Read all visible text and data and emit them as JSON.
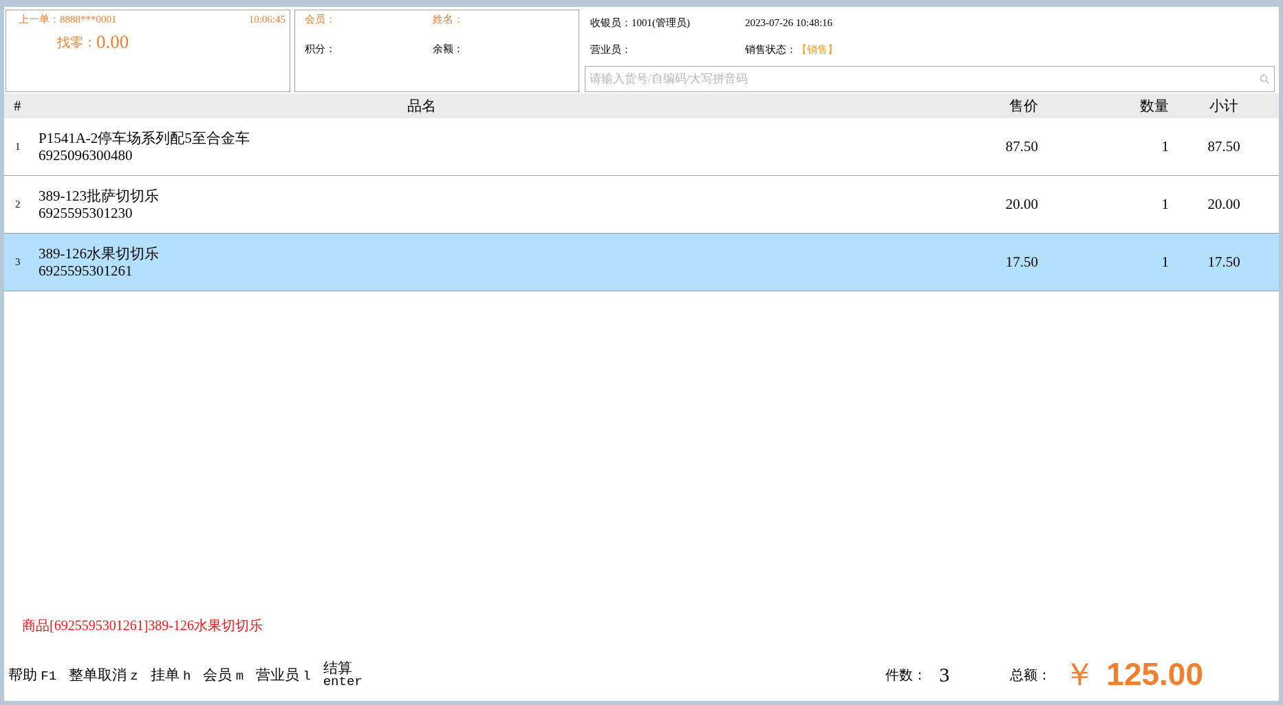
{
  "last_order": {
    "label": "上一单：8888***0001",
    "time": "10:06:45",
    "change_label": "找零：",
    "change_value": "0.00"
  },
  "member": {
    "member_label": "会员：",
    "name_label": "姓名：",
    "points_label": "积分：",
    "balance_label": "余额："
  },
  "info": {
    "cashier": "收银员：1001(管理员)",
    "datetime": "2023-07-26 10:48:16",
    "salesperson": "营业员：",
    "status_label": "销售状态：",
    "status_value": "【销售】"
  },
  "search": {
    "placeholder": "请输入货号/自编码/大写拼音码"
  },
  "table": {
    "columns": [
      "#",
      "品名",
      "售价",
      "数量",
      "小计"
    ],
    "rows": [
      {
        "index": "1",
        "name": "P1541A-2停车场系列配5至合金车",
        "code": "6925096300480",
        "price": "87.50",
        "qty": "1",
        "subtotal": "87.50",
        "selected": false
      },
      {
        "index": "2",
        "name": "389-123批萨切切乐",
        "code": "6925595301230",
        "price": "20.00",
        "qty": "1",
        "subtotal": "20.00",
        "selected": false
      },
      {
        "index": "3",
        "name": "389-126水果切切乐",
        "code": "6925595301261",
        "price": "17.50",
        "qty": "1",
        "subtotal": "17.50",
        "selected": true
      }
    ]
  },
  "message": "商品[6925595301261]389-126水果切切乐",
  "shortcuts": [
    {
      "kind": "inline",
      "label": "帮助",
      "key": "F1"
    },
    {
      "kind": "inline",
      "label": "整单取消",
      "key": "z"
    },
    {
      "kind": "inline",
      "label": "挂单",
      "key": "h"
    },
    {
      "kind": "inline",
      "label": "会员",
      "key": "m"
    },
    {
      "kind": "inline",
      "label": "营业员",
      "key": "l"
    },
    {
      "kind": "stacked",
      "label": "结算",
      "key": "enter"
    }
  ],
  "totals": {
    "count_label": "件数：",
    "count": "3",
    "total_label": "总额：",
    "currency": "￥",
    "total": "125.00"
  }
}
